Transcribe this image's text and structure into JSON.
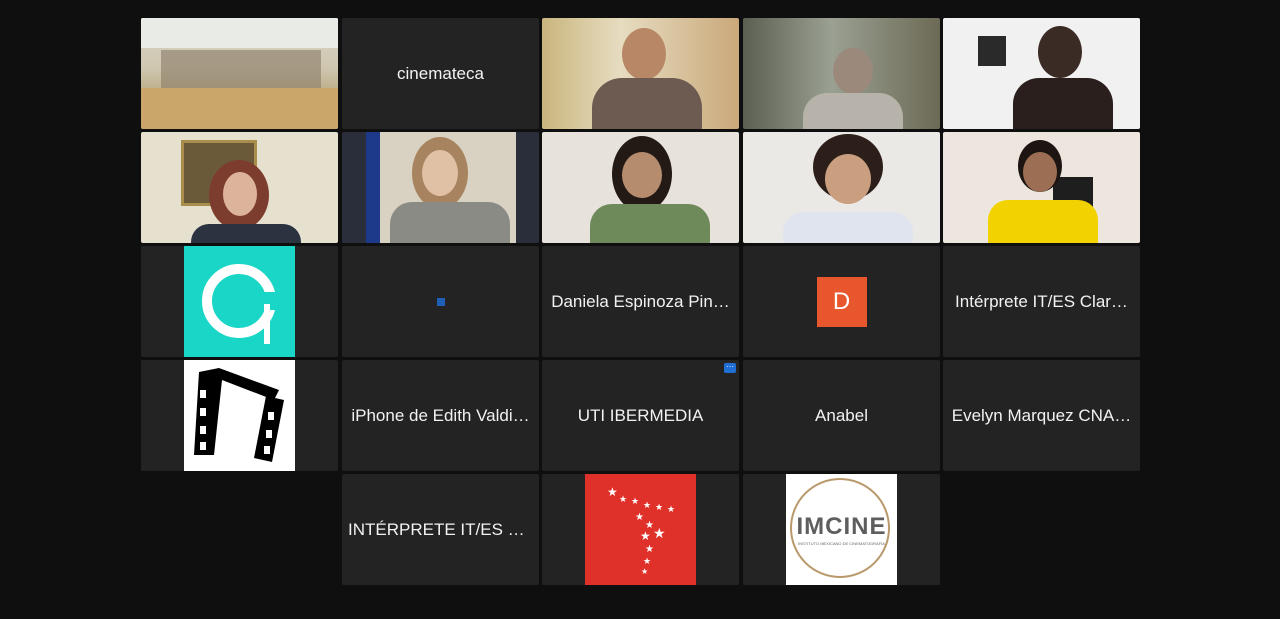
{
  "app": {
    "view": "gallery"
  },
  "tiles": [
    {
      "name": "",
      "type": "video",
      "active": true
    },
    {
      "name": "cinemateca",
      "type": "name"
    },
    {
      "name": "",
      "type": "video"
    },
    {
      "name": "",
      "type": "video"
    },
    {
      "name": "",
      "type": "video"
    },
    {
      "name": "",
      "type": "video"
    },
    {
      "name": "",
      "type": "video"
    },
    {
      "name": "",
      "type": "video"
    },
    {
      "name": "",
      "type": "video"
    },
    {
      "name": "",
      "type": "video"
    },
    {
      "name": "",
      "type": "avatar"
    },
    {
      "name": "",
      "type": "small-square"
    },
    {
      "name": "Daniela Espinoza Pin…",
      "type": "name"
    },
    {
      "name": "D",
      "type": "initial"
    },
    {
      "name": "Intérprete IT/ES Clar…",
      "type": "name"
    },
    {
      "name": "",
      "type": "avatar"
    },
    {
      "name": "iPhone de Edith Valdi…",
      "type": "name"
    },
    {
      "name": "UTI IBERMEDIA",
      "type": "name"
    },
    {
      "name": "Anabel",
      "type": "name"
    },
    {
      "name": "Evelyn Marquez CNA…",
      "type": "name"
    },
    {
      "name": "INTÉRPRETE IT/ES V…",
      "type": "name"
    },
    {
      "name": "",
      "type": "avatar"
    },
    {
      "name": "",
      "type": "avatar"
    }
  ],
  "logos": {
    "imcine_main": "IMCINE",
    "imcine_sub": "INSTITUTO MEXICANO DE CINEMATOGRAFÍA"
  },
  "colors": {
    "background": "#0f0f0f",
    "tile": "#232323",
    "active_border": "#23d160",
    "initial_avatar": "#e8562d",
    "teal_logo": "#1ad6c6",
    "red_logo": "#e0302a"
  }
}
